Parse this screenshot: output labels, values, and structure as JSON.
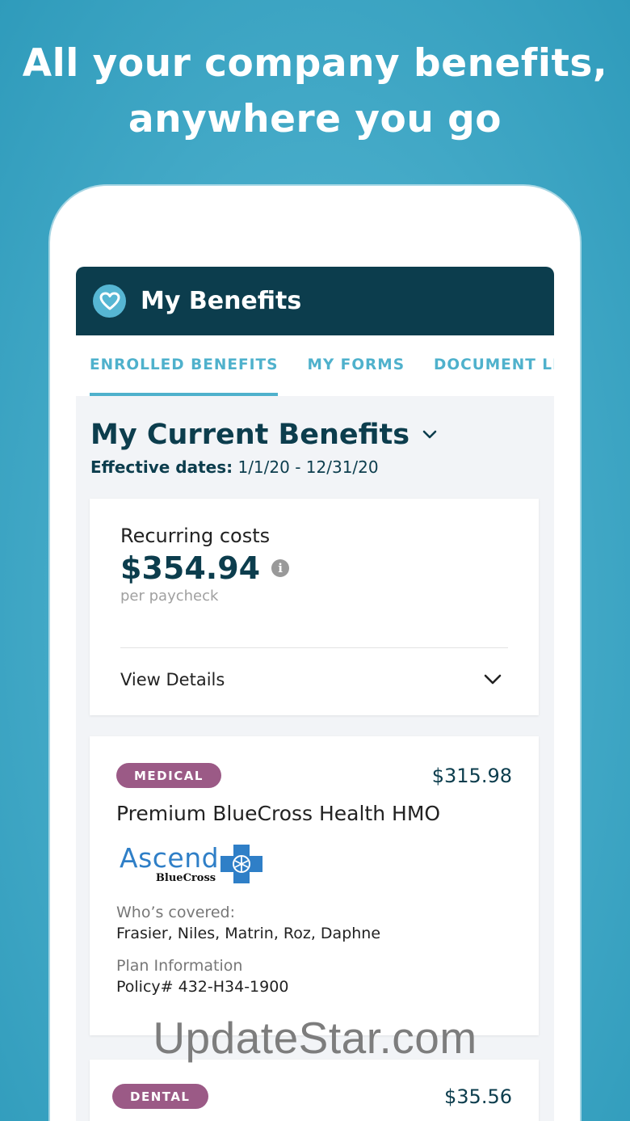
{
  "headline": {
    "line1": "All your company benefits,",
    "line2": "anywhere you go"
  },
  "app": {
    "title": "My Benefits",
    "logo_icon": "heart-logo-icon"
  },
  "tabs": [
    {
      "label": "ENROLLED BENEFITS",
      "active": true
    },
    {
      "label": "MY FORMS",
      "active": false
    },
    {
      "label": "DOCUMENT LIBRA",
      "active": false
    }
  ],
  "section": {
    "title": "My Current Benefits",
    "effective_label": "Effective dates:",
    "effective_value": "1/1/20 - 12/31/20"
  },
  "recurring": {
    "label": "Recurring costs",
    "amount": "$354.94",
    "info_icon": "i",
    "sub": "per paycheck",
    "details_label": "View Details"
  },
  "plans": [
    {
      "badge": "MEDICAL",
      "price": "$315.98",
      "name": "Premium BlueCross Health HMO",
      "carrier_word": "Ascend",
      "carrier_sub": "BlueCross",
      "covered_label": "Who’s covered:",
      "covered_value": "Frasier, Niles, Matrin, Roz, Daphne",
      "plan_info_label": "Plan Information",
      "plan_info_value": "Policy# 432-H34-1900"
    },
    {
      "badge": "DENTAL",
      "price": "$35.56"
    }
  ],
  "watermark": "UpdateStar.com",
  "colors": {
    "background": "#3aa5c4",
    "appbar": "#0c3d4d",
    "accent": "#4fb1cc",
    "badge": "#9b5a86"
  }
}
